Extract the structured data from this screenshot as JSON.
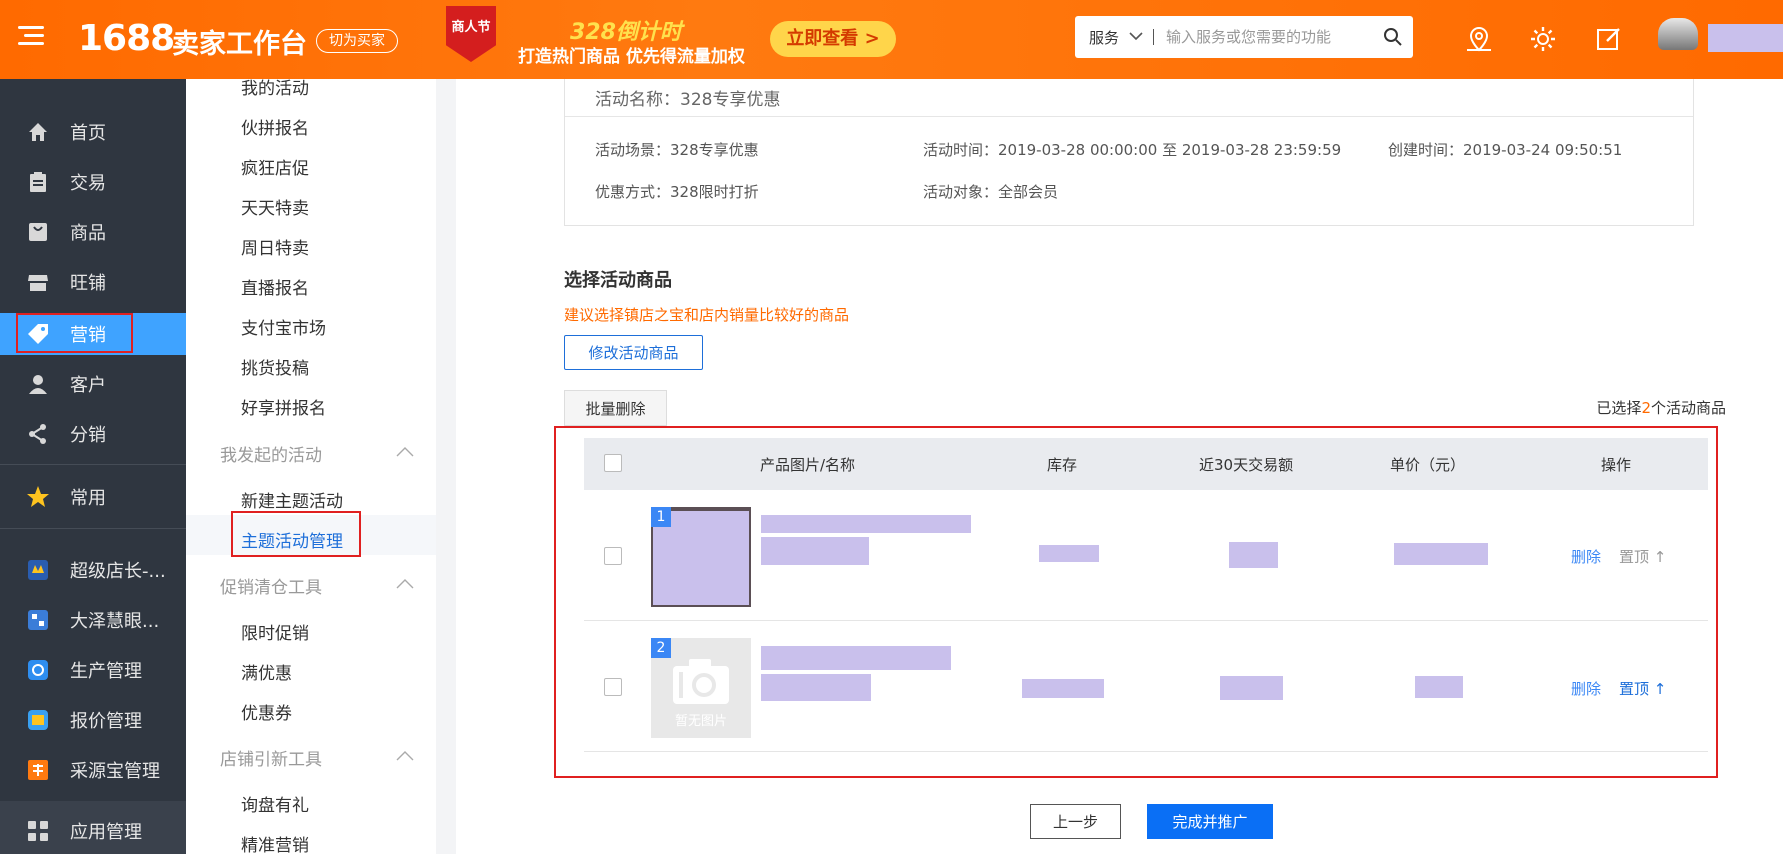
{
  "header": {
    "logo_num": "1688",
    "logo_text": "卖家工作台",
    "switch_label": "切为买家",
    "promo_badge": "商人节",
    "promo_title": "328倒计时",
    "promo_sub": "打造热门商品 优先得流量加权",
    "promo_btn": "立即查看 >",
    "search_scope": "服务",
    "search_placeholder": "输入服务或您需要的功能",
    "accent": "#ff6a00"
  },
  "sidebar": {
    "items": [
      {
        "label": "首页",
        "icon": "home-icon"
      },
      {
        "label": "交易",
        "icon": "clipboard-icon"
      },
      {
        "label": "商品",
        "icon": "bag-icon"
      },
      {
        "label": "旺铺",
        "icon": "store-icon"
      },
      {
        "label": "营销",
        "icon": "tag-icon",
        "active": true
      },
      {
        "label": "客户",
        "icon": "user-icon"
      },
      {
        "label": "分销",
        "icon": "share-icon"
      },
      {
        "label": "常用",
        "icon": "star-icon"
      },
      {
        "label": "超级店长-...",
        "icon": "app-icon"
      },
      {
        "label": "大泽慧眼...",
        "icon": "app-icon"
      },
      {
        "label": "生产管理",
        "icon": "app-icon"
      },
      {
        "label": "报价管理",
        "icon": "app-icon"
      },
      {
        "label": "采源宝管理",
        "icon": "app-icon"
      },
      {
        "label": "应用管理",
        "icon": "grid-icon"
      }
    ],
    "active_color": "#3fa3ff"
  },
  "submenu": {
    "items_top": [
      "我的活动",
      "伙拼报名",
      "疯狂店促",
      "天天特卖",
      "周日特卖",
      "直播报名",
      "支付宝市场",
      "挑货投稿",
      "好享拼报名"
    ],
    "group1": "我发起的活动",
    "group1_items": [
      "新建主题活动",
      "主题活动管理"
    ],
    "group2": "促销清仓工具",
    "group2_items": [
      "限时促销",
      "满优惠",
      "优惠券"
    ],
    "group3": "店铺引新工具",
    "group3_items": [
      "询盘有礼",
      "精准营销"
    ]
  },
  "activity": {
    "name_label": "活动名称：328专享优惠",
    "scene": "活动场景：328专享优惠",
    "time": "活动时间：2019-03-28 00:00:00 至 2019-03-28 23:59:59",
    "created": "创建时间：2019-03-24 09:50:51",
    "discount": "优惠方式：328限时打折",
    "target": "活动对象：全部会员"
  },
  "select_section": {
    "title": "选择活动商品",
    "tip": "建议选择镇店之宝和店内销量比较好的商品",
    "modify_btn": "修改活动商品",
    "batch_delete": "批量删除",
    "selected_prefix": "已选择",
    "selected_num": "2",
    "selected_suffix": "个活动商品"
  },
  "table": {
    "headers": [
      "产品图片/名称",
      "库存",
      "近30天交易额",
      "单价（元）",
      "操作"
    ],
    "rows": [
      {
        "index": "1",
        "delete": "删除",
        "pin": "置顶"
      },
      {
        "index": "2",
        "no_image": "暂无图片",
        "delete": "删除",
        "pin": "置顶"
      }
    ]
  },
  "footer": {
    "prev": "上一步",
    "finish": "完成并推广"
  }
}
